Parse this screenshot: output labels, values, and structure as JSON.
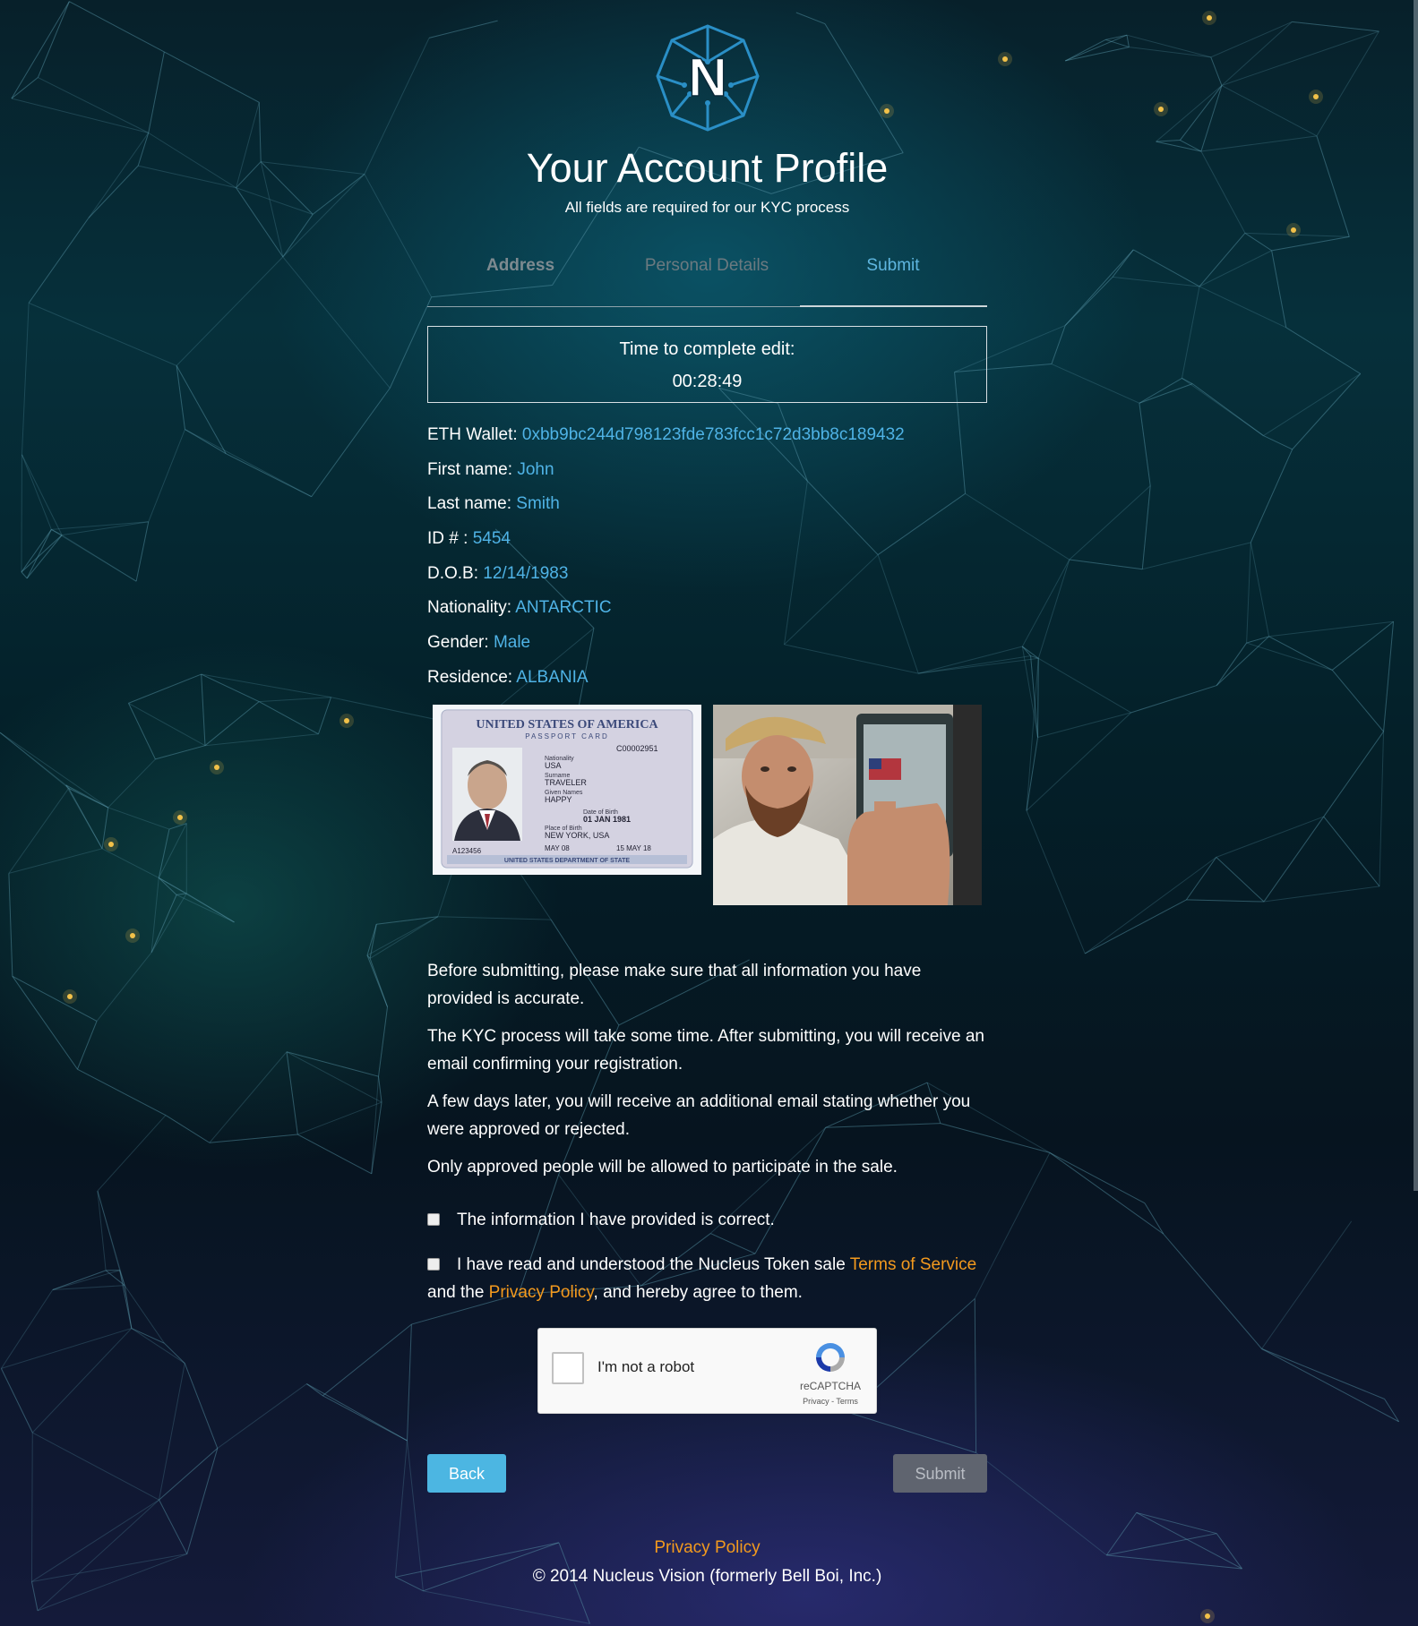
{
  "header": {
    "logo_letter": "N",
    "title": "Your Account Profile",
    "subtitle": "All fields are required for our KYC process"
  },
  "steps": [
    {
      "label": "Address",
      "state": "inactive"
    },
    {
      "label": "Personal Details",
      "state": "inactive"
    },
    {
      "label": "Submit",
      "state": "active"
    }
  ],
  "timer": {
    "label": "Time to complete edit:",
    "value": "00:28:49"
  },
  "fields": [
    {
      "label": "ETH Wallet:",
      "value": "0xbb9bc244d798123fde783fcc1c72d3bb8c189432"
    },
    {
      "label": "First name:",
      "value": "John"
    },
    {
      "label": "Last name:",
      "value": "Smith"
    },
    {
      "label": "ID # :",
      "value": "5454"
    },
    {
      "label": "D.O.B:",
      "value": "12/14/1983"
    },
    {
      "label": "Nationality:",
      "value": "ANTARCTIC"
    },
    {
      "label": "Gender:",
      "value": "Male"
    },
    {
      "label": "Residence:",
      "value": "ALBANIA"
    }
  ],
  "images": {
    "id_card": {
      "title": "UNITED STATES OF AMERICA",
      "subtitle": "PASSPORT CARD",
      "card_no": "C00002951",
      "nationality": "USA",
      "surname": "TRAVELER",
      "given_names": "HAPPY",
      "dob": "01 JAN 1981",
      "place_of_birth": "NEW YORK, USA",
      "issued": "MAY 08",
      "expires": "15 MAY 18",
      "footer": "UNITED STATES DEPARTMENT OF STATE",
      "number": "A123456"
    }
  },
  "info": [
    "Before submitting, please make sure that all information you have provided is accurate.",
    "The KYC process will take some time. After submitting, you will receive an email confirming your registration.",
    "A few days later, you will receive an additional email stating whether you were approved or rejected.",
    "Only approved people will be allowed to participate in the sale."
  ],
  "checkboxes": {
    "correct": {
      "label": "The information I have provided is correct.",
      "checked": false
    },
    "terms": {
      "prefix": "I have read and understood the Nucleus Token sale ",
      "tos_link": "Terms of Service",
      "middle": "and the ",
      "privacy_link": "Privacy Policy",
      "suffix": ", and hereby agree to them.",
      "checked": false
    }
  },
  "captcha": {
    "label": "I'm not a robot",
    "brand": "reCAPTCHA",
    "terms": "Privacy - Terms"
  },
  "buttons": {
    "back": "Back",
    "submit": "Submit"
  },
  "footer": {
    "privacy_link": "Privacy Policy",
    "copyright": "© 2014 Nucleus Vision (formerly Bell Boi, Inc.)"
  },
  "colors": {
    "value_blue": "#4fb3e6",
    "link_orange": "#f39a1e",
    "back_button": "#4cb6e2",
    "submit_button": "#5f646f"
  }
}
